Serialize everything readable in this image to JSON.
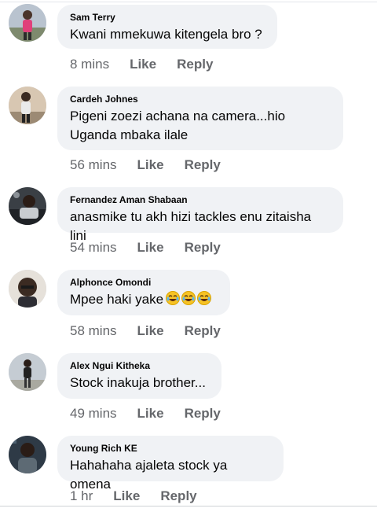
{
  "comments": [
    {
      "author": "Sam Terry",
      "text": "Kwani mmekuwa kitengela bro ?",
      "time": "8 mins",
      "like": "Like",
      "reply": "Reply"
    },
    {
      "author": "Cardeh Johnes",
      "text": "Pigeni zoezi achana na camera...hio Uganda mbaka ilale",
      "time": "56 mins",
      "like": "Like",
      "reply": "Reply"
    },
    {
      "author": "Fernandez Aman Shabaan",
      "text": "anasmike tu akh hizi tackles enu zitaisha lini",
      "time": "54 mins",
      "like": "Like",
      "reply": "Reply"
    },
    {
      "author": "Alphonce Omondi",
      "text": "Mpee haki yake",
      "emoji": "😂😂😂",
      "time": "58 mins",
      "like": "Like",
      "reply": "Reply"
    },
    {
      "author": "Alex Ngui Kitheka",
      "text": "Stock inakuja brother...",
      "time": "49 mins",
      "like": "Like",
      "reply": "Reply"
    },
    {
      "author": "Young Rich KE",
      "text": "Hahahaha ajaleta stock ya omena",
      "time": "1 hr",
      "like": "Like",
      "reply": "Reply"
    }
  ]
}
